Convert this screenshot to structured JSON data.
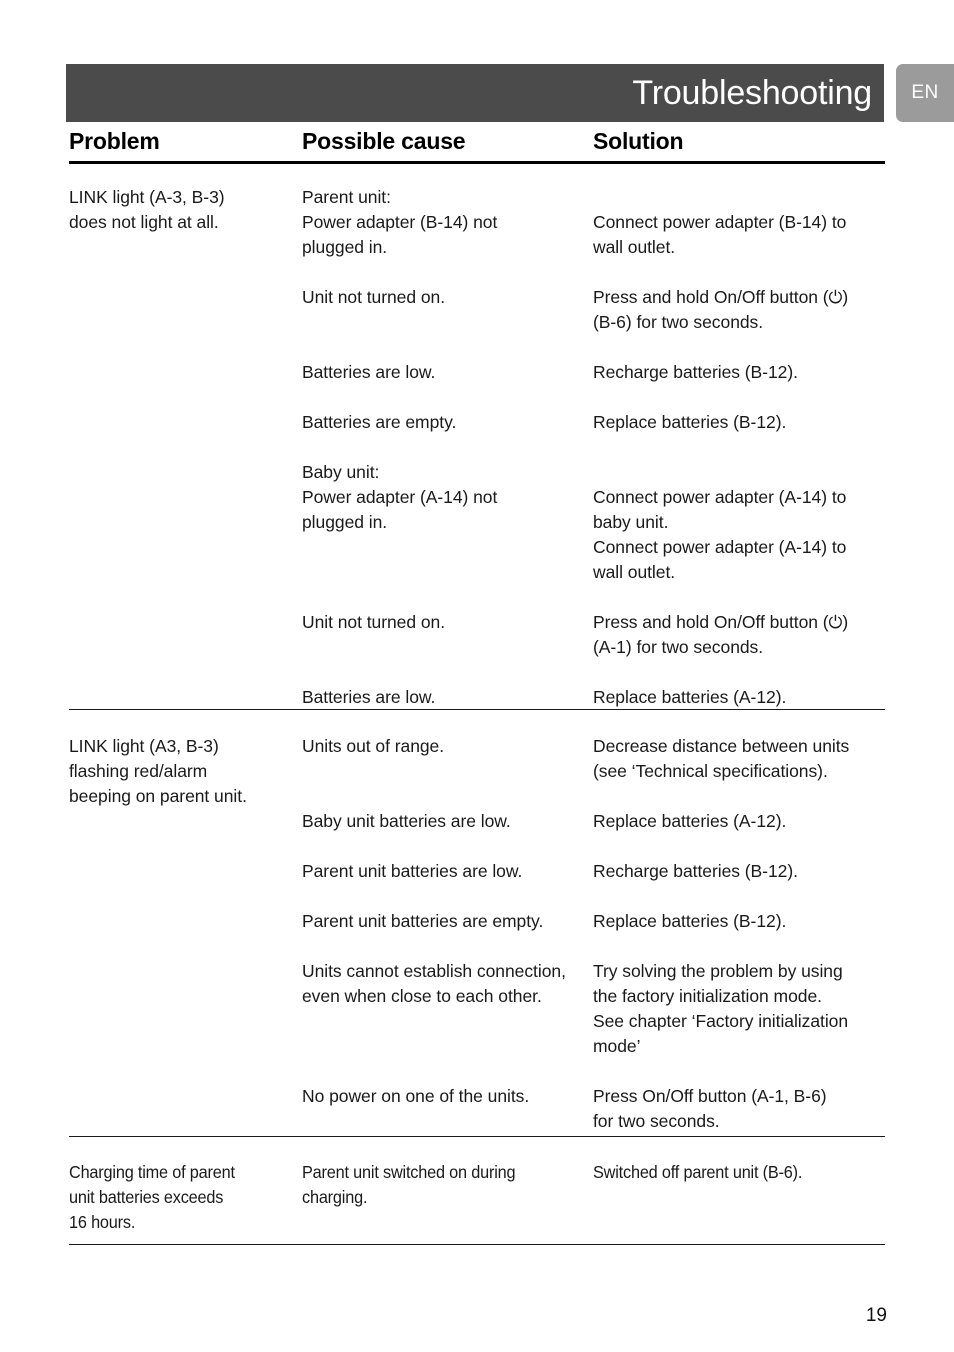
{
  "header": {
    "title": "Troubleshooting",
    "language_badge": "EN"
  },
  "columns": {
    "problem": "Problem",
    "possible_cause": "Possible cause",
    "solution": "Solution"
  },
  "footer": {
    "page_number": "19"
  },
  "colors": {
    "header_band": "#4b4b4b",
    "language_badge": "#9b9b9b",
    "text": "#1a1a1a",
    "rule": "#000000"
  },
  "icons": {
    "power_symbol": "⏻"
  },
  "table": {
    "sections": [
      {
        "problem": "LINK light (A-3, B-3)\ndoes not light at all.",
        "rows": [
          {
            "cause": "Parent unit:\nPower adapter (B-14) not\nplugged in.",
            "solution": "Connect power adapter (B-14) to\nwall outlet."
          },
          {
            "cause": "Unit not turned on.",
            "solution_pre": "Press and hold On/Off button (",
            "solution_post": ")\n(B-6) for two seconds.",
            "solution": "Press and hold On/Off button (⏻)\n(B-6) for two seconds."
          },
          {
            "cause": "Batteries are low.",
            "solution": "Recharge batteries (B-12)."
          },
          {
            "cause": "Batteries are empty.",
            "solution": "Replace batteries (B-12)."
          },
          {
            "cause": "Baby unit:\nPower adapter (A-14) not\nplugged in.",
            "solution": "Connect power adapter (A-14) to\nbaby unit.\nConnect power adapter (A-14) to\nwall outlet."
          },
          {
            "cause": "Unit not turned on.",
            "solution_pre": "Press and hold On/Off button (",
            "solution_post": ")\n(A-1) for two seconds.",
            "solution": "Press and hold On/Off button (⏻)\n(A-1) for two seconds."
          },
          {
            "cause": "Batteries are low.",
            "solution": "Replace batteries (A-12)."
          }
        ]
      },
      {
        "problem": "LINK light (A3, B-3)\nflashing red/alarm\nbeeping on parent unit.",
        "rows": [
          {
            "cause": "Units out of range.",
            "solution": "Decrease distance between units\n(see ‘Technical specifications)."
          },
          {
            "cause": "Baby unit batteries are low.",
            "solution": "Replace batteries (A-12)."
          },
          {
            "cause": "Parent unit batteries are low.",
            "solution": "Recharge batteries (B-12)."
          },
          {
            "cause": "Parent unit batteries are empty.",
            "solution": "Replace batteries (B-12)."
          },
          {
            "cause": "Units cannot establish connection,\neven when close to each other.",
            "solution": "Try solving the problem by using\nthe factory initialization mode.\nSee chapter ‘Factory initialization\nmode’"
          },
          {
            "cause": "No power on one of the units.",
            "solution": "Press On/Off button (A-1, B-6)\nfor two seconds."
          }
        ]
      },
      {
        "problem": "Charging time of parent\nunit batteries exceeds\n16 hours.",
        "rows": [
          {
            "cause": "Parent unit switched on during\ncharging.",
            "solution": "Switched off parent unit (B-6)."
          }
        ]
      }
    ]
  }
}
